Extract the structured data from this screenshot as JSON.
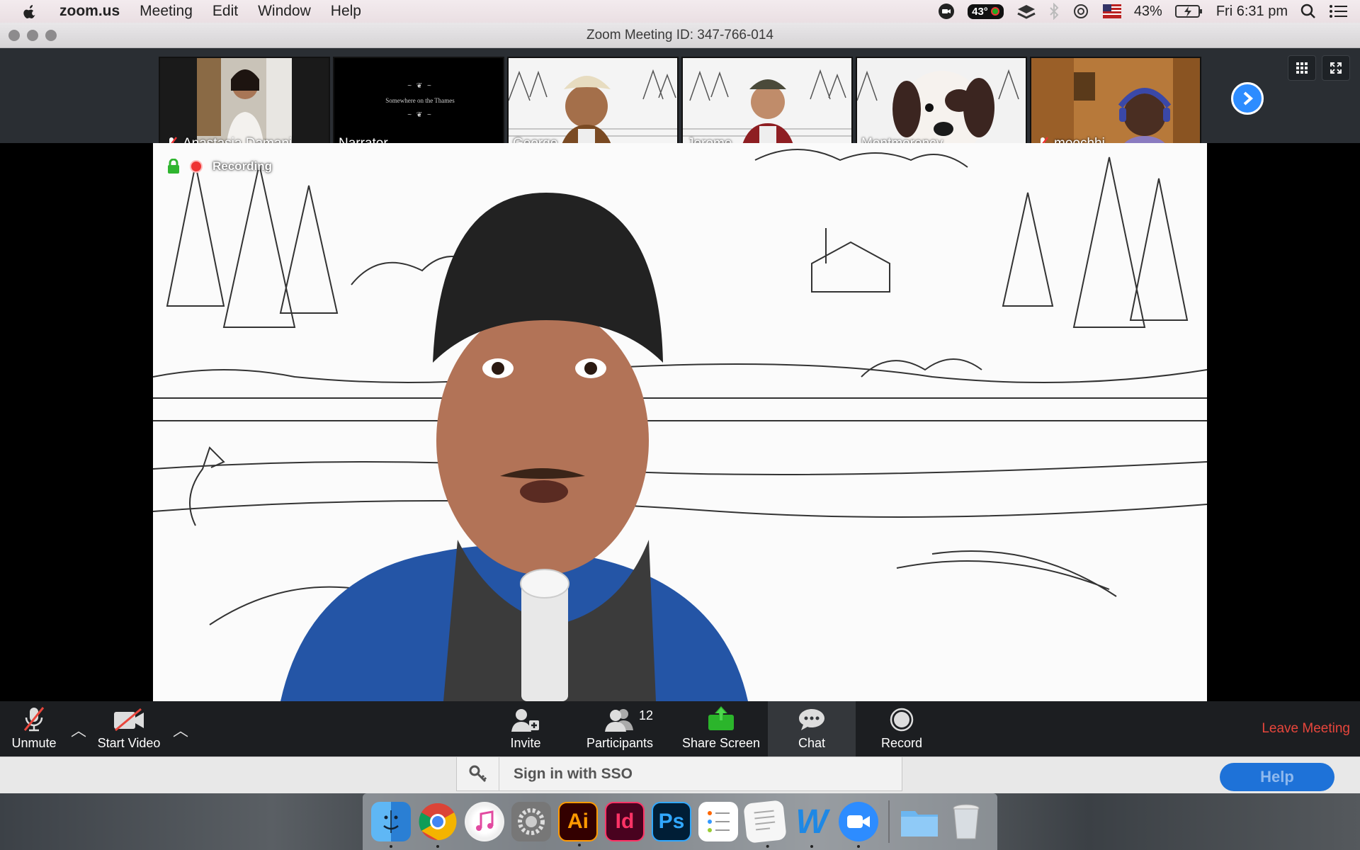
{
  "menubar": {
    "app_name": "zoom.us",
    "items": [
      "Meeting",
      "Edit",
      "Window",
      "Help"
    ],
    "temperature": "43°",
    "battery": "43%",
    "clock": "Fri 6:31 pm"
  },
  "window": {
    "title": "Zoom Meeting ID: 347-766-014"
  },
  "participants": [
    {
      "name": "Anastasia Damani",
      "muted": true
    },
    {
      "name": "Narrator",
      "muted": false,
      "slide_text": "Somewhere on the Thames"
    },
    {
      "name": "George",
      "muted": false
    },
    {
      "name": "Jerome",
      "muted": false
    },
    {
      "name": "Montmorency",
      "muted": false
    },
    {
      "name": "moochhi",
      "muted": true
    }
  ],
  "stage": {
    "recording_label": "Recording"
  },
  "toolbar": {
    "unmute": "Unmute",
    "start_video": "Start Video",
    "invite": "Invite",
    "participants": "Participants",
    "participants_count": "12",
    "share_screen": "Share Screen",
    "chat": "Chat",
    "record": "Record",
    "leave": "Leave Meeting"
  },
  "login": {
    "sso_label": "Sign in with SSO",
    "help_label": "Help"
  },
  "dock": {
    "apps": [
      "finder-icon",
      "chrome-icon",
      "itunes-icon",
      "system-preferences-icon",
      "illustrator-icon",
      "indesign-icon",
      "photoshop-icon",
      "reminders-icon",
      "textedit-icon",
      "word-icon",
      "zoom-icon",
      "folder-icon",
      "trash-icon"
    ],
    "illustrator_label": "Ai",
    "indesign_label": "Id",
    "photoshop_label": "Ps",
    "word_label": "W"
  }
}
